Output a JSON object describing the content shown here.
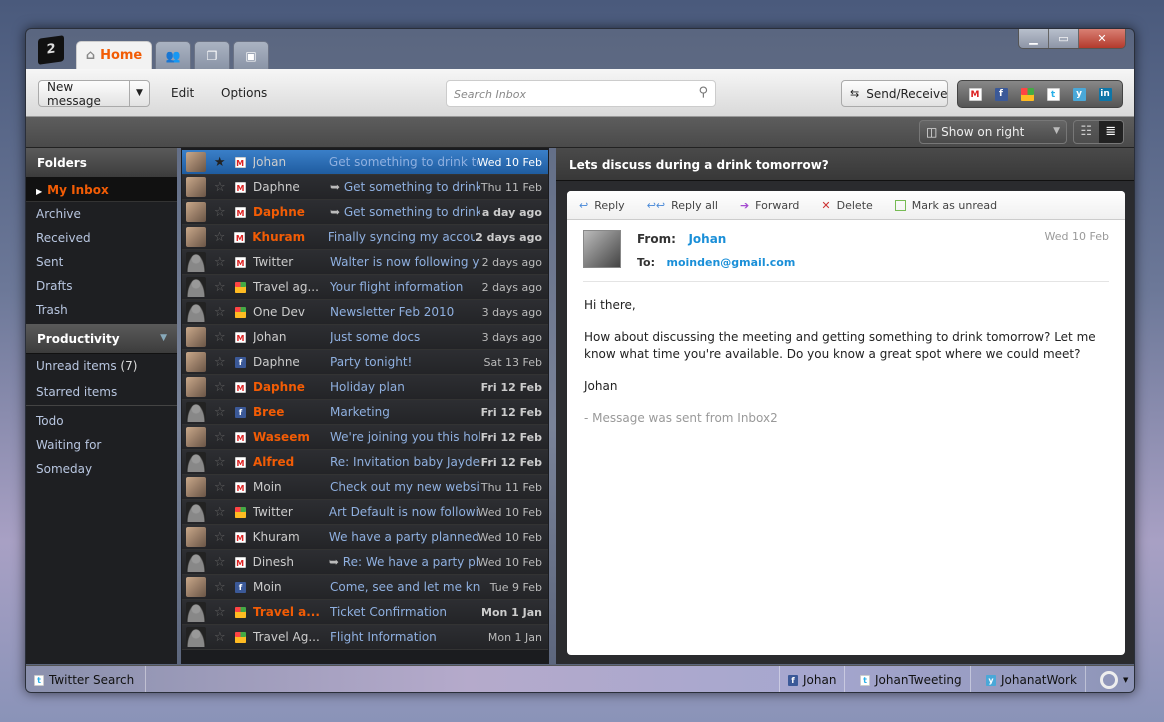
{
  "app": {
    "logo_text": "2",
    "tabs": [
      {
        "label": "Home",
        "icon": "home-icon"
      },
      {
        "icon": "contacts-icon"
      },
      {
        "icon": "documents-icon"
      },
      {
        "icon": "pictures-icon"
      }
    ]
  },
  "toolbar": {
    "new_message": "New message",
    "edit": "Edit",
    "options": "Options",
    "search_placeholder": "Search Inbox",
    "send_receive": "Send/Receive",
    "services": [
      "gmail",
      "facebook",
      "windows",
      "twitter",
      "yammer",
      "linkedin"
    ]
  },
  "subbar": {
    "reading_pane": "Show on right"
  },
  "sidebar": {
    "folders_title": "Folders",
    "folders": [
      "My Inbox",
      "Archive",
      "Received",
      "Sent",
      "Drafts",
      "Trash"
    ],
    "productivity_title": "Productivity",
    "productivity": [
      {
        "label": "Unread items",
        "count": "(7)"
      },
      {
        "label": "Starred items"
      }
    ],
    "gtd": [
      "Todo",
      "Waiting for",
      "Someday"
    ]
  },
  "messages": [
    {
      "avatar": "photo",
      "starred": true,
      "service": "gmail",
      "sender": "Johan",
      "subject": "Get something to drink tomorrow?",
      "date": "Wed 10 Feb",
      "unread": false,
      "selected": true
    },
    {
      "avatar": "photo",
      "service": "gmail",
      "sender": "Daphne",
      "subject": "Get something to drink tomorrow?",
      "date": "Thu 11 Feb",
      "reply": true
    },
    {
      "avatar": "photo",
      "service": "gmail",
      "sender": "Daphne",
      "subject": "Get something to drink tomorrow?",
      "date": "a day ago",
      "unread": true,
      "reply": true
    },
    {
      "avatar": "photo",
      "service": "gmail",
      "sender": "Khuram",
      "subject": "Finally syncing my accounts",
      "date": "2 days ago",
      "unread": true
    },
    {
      "avatar": "generic",
      "service": "gmail",
      "sender": "Twitter",
      "subject": "Walter is now following you",
      "date": "2 days ago"
    },
    {
      "avatar": "generic",
      "service": "windows",
      "sender": "Travel ag...",
      "subject": "Your flight information",
      "date": "2 days ago"
    },
    {
      "avatar": "generic",
      "service": "windows",
      "sender": "One Dev",
      "subject": "Newsletter Feb 2010",
      "date": "3 days ago"
    },
    {
      "avatar": "photo",
      "service": "gmail",
      "sender": "Johan",
      "subject": "Just some docs",
      "date": "3 days ago"
    },
    {
      "avatar": "photo",
      "service": "facebook",
      "sender": "Daphne",
      "subject": "Party tonight!",
      "date": "Sat 13 Feb"
    },
    {
      "avatar": "photo",
      "service": "gmail",
      "sender": "Daphne",
      "subject": "Holiday plan",
      "date": "Fri 12 Feb",
      "unread": true
    },
    {
      "avatar": "generic",
      "service": "facebook",
      "sender": "Bree",
      "subject": "Marketing",
      "date": "Fri 12 Feb",
      "unread": true
    },
    {
      "avatar": "photo",
      "service": "gmail",
      "sender": "Waseem",
      "subject": "We're joining you this holiday",
      "date": "Fri 12 Feb",
      "unread": true
    },
    {
      "avatar": "generic",
      "service": "gmail",
      "sender": "Alfred",
      "subject": "Re: Invitation baby Jayden",
      "date": "Fri 12 Feb",
      "unread": true
    },
    {
      "avatar": "photo",
      "service": "gmail",
      "sender": "Moin",
      "subject": "Check out my new website. F",
      "date": "Thu 11 Feb"
    },
    {
      "avatar": "generic",
      "service": "windows",
      "sender": "Twitter",
      "subject": "Art Default is now following you",
      "date": "Wed 10 Feb"
    },
    {
      "avatar": "photo",
      "service": "gmail",
      "sender": "Khuram",
      "subject": "We have a party planned for",
      "date": "Wed 10 Feb"
    },
    {
      "avatar": "generic",
      "service": "gmail",
      "sender": "Dinesh",
      "subject": "Re: We have a party planned",
      "date": "Wed 10 Feb",
      "reply": true
    },
    {
      "avatar": "photo",
      "service": "facebook",
      "sender": "Moin",
      "subject": "Come, see and let me know...",
      "date": "Tue 9 Feb"
    },
    {
      "avatar": "generic",
      "service": "windows",
      "sender": "Travel a...",
      "subject": "Ticket Confirmation",
      "date": "Mon 1 Jan",
      "unread": true
    },
    {
      "avatar": "generic",
      "service": "windows",
      "sender": "Travel Ag...",
      "subject": "Flight Information",
      "date": "Mon 1 Jan"
    }
  ],
  "reader": {
    "title": "Lets discuss during a drink tomorrow?",
    "actions": {
      "reply": "Reply",
      "reply_all": "Reply all",
      "forward": "Forward",
      "delete": "Delete",
      "mark_unread": "Mark as unread"
    },
    "from_label": "From:",
    "from": "Johan",
    "to_label": "To:",
    "to": "moinden@gmail.com",
    "date": "Wed 10 Feb",
    "body": [
      "Hi there,",
      "How about discussing the meeting and getting something to drink tomorrow? Let me know what time you're available. Do you know a great spot where we could meet?",
      "Johan"
    ],
    "signature": "- Message was sent from Inbox2"
  },
  "bottom": {
    "left": "Twitter Search",
    "accounts": [
      {
        "service": "facebook",
        "label": "Johan"
      },
      {
        "service": "twitter",
        "label": "JohanTweeting"
      },
      {
        "service": "yammer",
        "label": "JohanatWork"
      }
    ]
  },
  "colors": {
    "accent": "#f25c05",
    "link": "#1a8fd8",
    "selected": "#2f6fb5"
  }
}
